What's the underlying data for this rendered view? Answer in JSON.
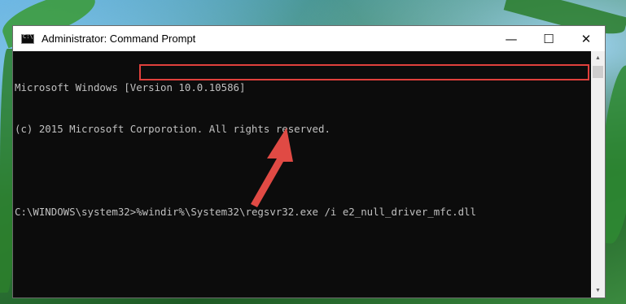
{
  "window": {
    "title": "Administrator: Command Prompt",
    "minimize_icon": "minimize-icon",
    "maximize_icon": "maximize-icon",
    "close_icon": "close-icon"
  },
  "console": {
    "lines": [
      "Microsoft Windows [Version 10.0.10586]",
      "(c) 2015 Microsoft Corporotion. All rights reserved."
    ],
    "prompt": "C:\\WINDOWS\\system32>",
    "command": "%windir%\\System32\\regsvr32.exe /i e2_null_driver_mfc.dll"
  },
  "colors": {
    "highlight": "#e0403c",
    "arrow": "#e04a44"
  }
}
